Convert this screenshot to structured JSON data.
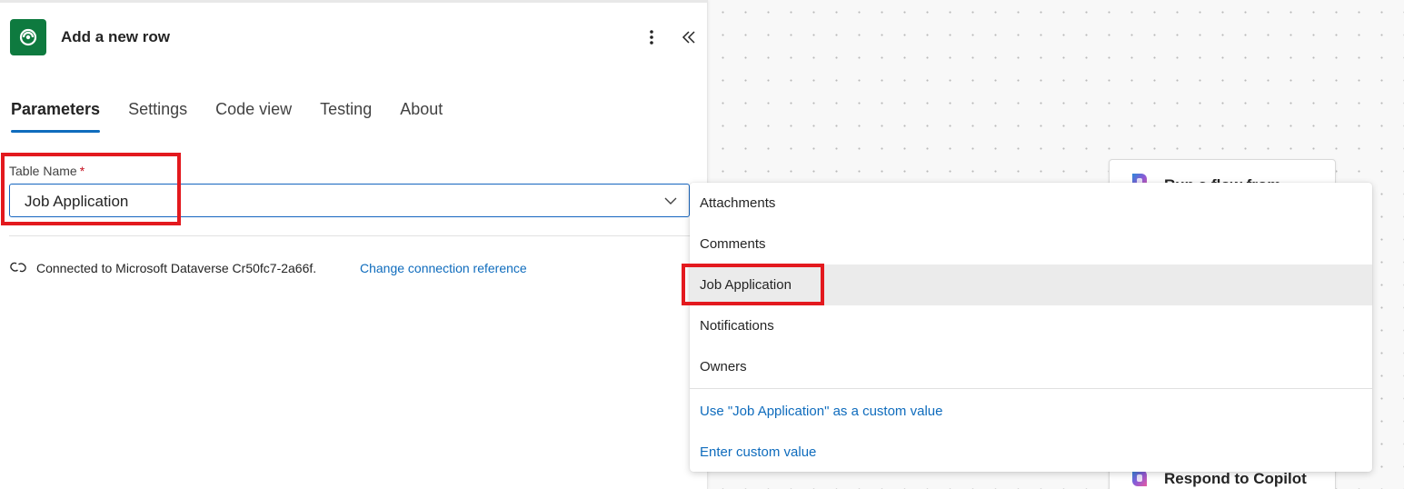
{
  "panel": {
    "title": "Add a new row",
    "icon": "dataverse-icon",
    "more_icon": "more-vertical-icon",
    "collapse_icon": "double-chevron-left-icon"
  },
  "tabs": [
    {
      "label": "Parameters",
      "active": true
    },
    {
      "label": "Settings",
      "active": false
    },
    {
      "label": "Code view",
      "active": false
    },
    {
      "label": "Testing",
      "active": false
    },
    {
      "label": "About",
      "active": false
    }
  ],
  "field": {
    "label": "Table Name",
    "required_marker": "*",
    "value": "Job Application"
  },
  "connection": {
    "text": "Connected to Microsoft Dataverse Cr50fc7-2a66f.",
    "link": "Change connection reference"
  },
  "dropdown": {
    "options": [
      "Attachments",
      "Comments",
      "Job Application",
      "Notifications",
      "Owners"
    ],
    "selected": "Job Application",
    "custom_value_option": "Use \"Job Application\" as a custom value",
    "enter_custom": "Enter custom value"
  },
  "canvas": {
    "cards": [
      {
        "title": "Run a flow from"
      },
      {
        "title": "Respond to Copilot"
      }
    ]
  },
  "colors": {
    "accent": "#0f6cbd",
    "brand_green": "#0e7a3f",
    "highlight": "#e3191e"
  }
}
